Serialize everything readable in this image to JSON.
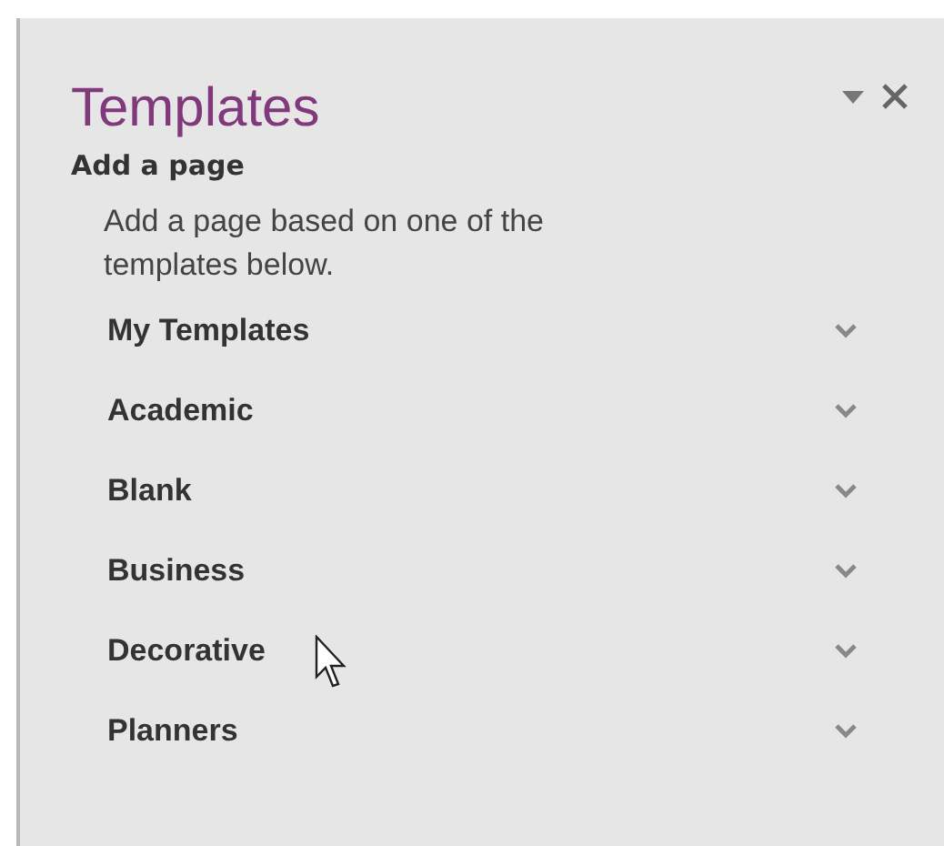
{
  "pane": {
    "title": "Templates",
    "section": "Add a page",
    "description": "Add a page based on one of the templates below."
  },
  "categories": [
    {
      "label": "My Templates",
      "expanded": false
    },
    {
      "label": "Academic",
      "expanded": false
    },
    {
      "label": "Blank",
      "expanded": false
    },
    {
      "label": "Business",
      "expanded": false
    },
    {
      "label": "Decorative",
      "expanded": false
    },
    {
      "label": "Planners",
      "expanded": false
    }
  ]
}
